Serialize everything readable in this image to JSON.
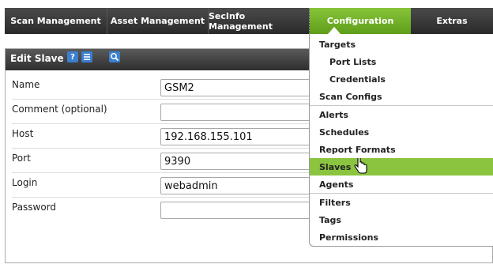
{
  "nav": {
    "items": [
      {
        "label": "Scan Management"
      },
      {
        "label": "Asset Management"
      },
      {
        "label": "SecInfo Management"
      },
      {
        "label": "Configuration"
      },
      {
        "label": "Extras"
      }
    ],
    "active_color": "#6fb027"
  },
  "panel": {
    "title": "Edit Slave",
    "help_icon": "question-icon",
    "list_icon": "list-icon",
    "search_icon": "search-icon"
  },
  "form": {
    "name": {
      "label": "Name",
      "value": "GSM2"
    },
    "comment": {
      "label": "Comment (optional)",
      "value": ""
    },
    "host": {
      "label": "Host",
      "value": "192.168.155.101"
    },
    "port": {
      "label": "Port",
      "value": "9390"
    },
    "login": {
      "label": "Login",
      "value": "webadmin"
    },
    "password": {
      "label": "Password",
      "value": ""
    }
  },
  "menu": {
    "items": [
      {
        "label": "Targets"
      },
      {
        "label": "Port Lists"
      },
      {
        "label": "Credentials"
      },
      {
        "label": "Scan Configs"
      },
      {
        "label": "Alerts"
      },
      {
        "label": "Schedules"
      },
      {
        "label": "Report Formats"
      },
      {
        "label": "Slaves"
      },
      {
        "label": "Agents"
      },
      {
        "label": "Filters"
      },
      {
        "label": "Tags"
      },
      {
        "label": "Permissions"
      }
    ],
    "selected": "Slaves",
    "selected_color": "#8bc43f"
  }
}
